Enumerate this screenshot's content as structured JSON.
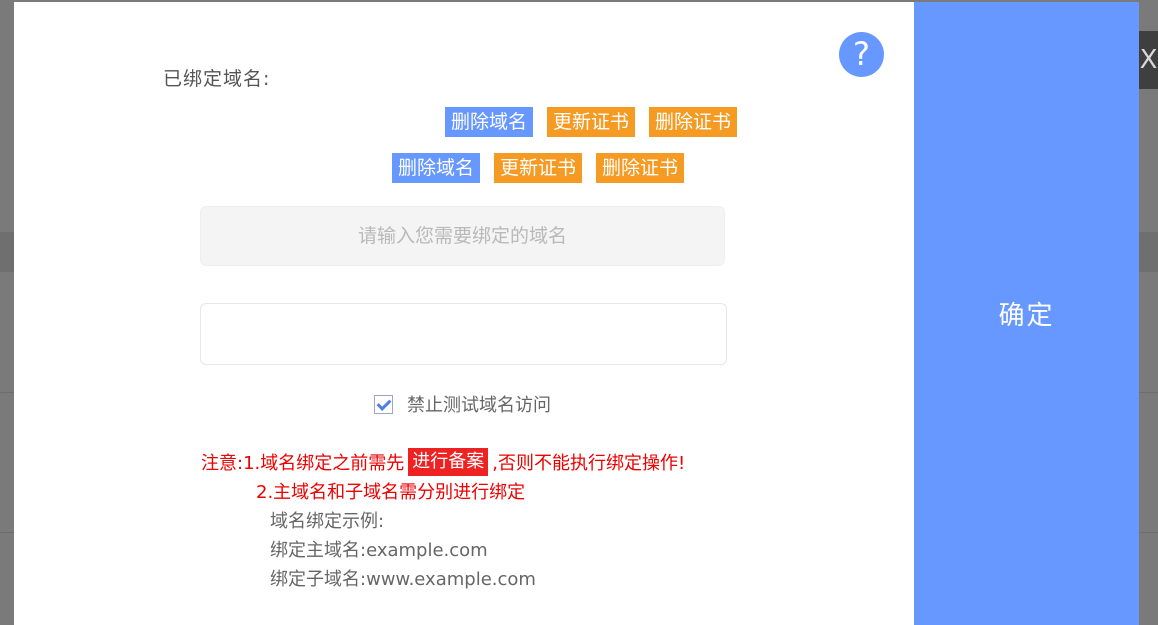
{
  "background": {
    "close_glyph": "X"
  },
  "dialog": {
    "help_icon": "?",
    "bound_label": "已绑定域名:",
    "domain_rows": [
      {
        "delete_domain": "删除域名",
        "update_cert": "更新证书",
        "delete_cert": "删除证书"
      },
      {
        "delete_domain": "删除域名",
        "update_cert": "更新证书",
        "delete_cert": "删除证书"
      }
    ],
    "domain_input_placeholder": "请输入您需要绑定的域名",
    "disable_test_label": "禁止测试域名访问",
    "disable_test_checked": true,
    "notice": {
      "prefix": "注意:1.域名绑定之前需先",
      "beian_link": "进行备案",
      "suffix": ",否则不能执行绑定操作!",
      "line2": "2.主域名和子域名需分别进行绑定"
    },
    "example": {
      "title": "域名绑定示例:",
      "main": "绑定主域名:example.com",
      "sub": "绑定子域名:www.example.com"
    },
    "confirm_label": "确定"
  },
  "colors": {
    "accent": "#6698ff",
    "orange": "#f59a23",
    "warning": "#ee0000"
  }
}
